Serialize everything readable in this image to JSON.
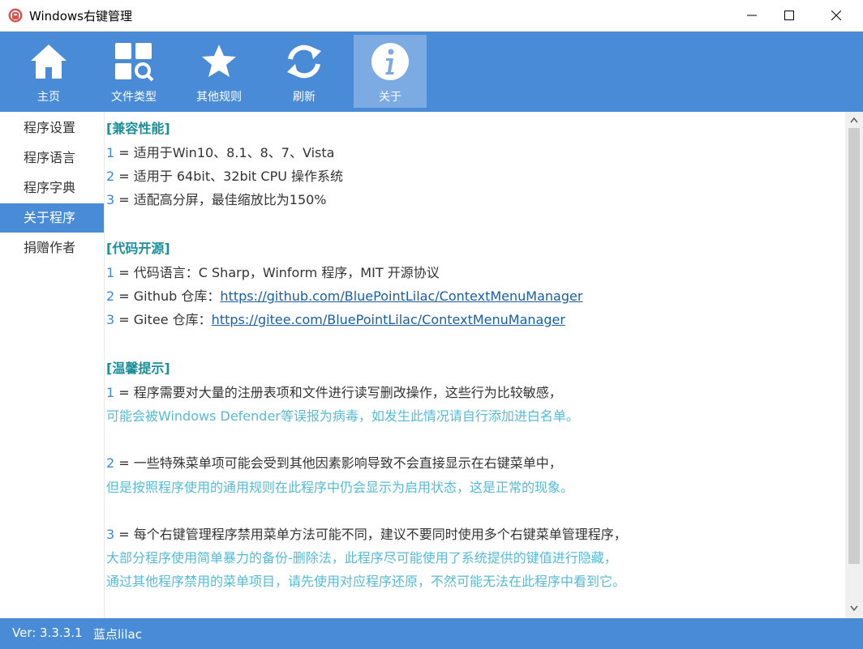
{
  "window": {
    "title": "Windows右键管理"
  },
  "toolbar": {
    "items": [
      {
        "label": "主页",
        "icon": "home-icon"
      },
      {
        "label": "文件类型",
        "icon": "file-type-search-icon"
      },
      {
        "label": "其他规则",
        "icon": "star-icon"
      },
      {
        "label": "刷新",
        "icon": "refresh-icon"
      },
      {
        "label": "关于",
        "icon": "info-icon",
        "active": true
      }
    ]
  },
  "sidebar": {
    "items": [
      {
        "label": "程序设置"
      },
      {
        "label": "程序语言"
      },
      {
        "label": "程序字典"
      },
      {
        "label": "关于程序",
        "active": true
      },
      {
        "label": "捐赠作者"
      }
    ]
  },
  "content": {
    "compat": {
      "heading": "[兼容性能]",
      "items": [
        {
          "num": "1",
          "text": " = 适用于Win10、8.1、8、7、Vista"
        },
        {
          "num": "2",
          "text": " = 适用于 64bit、32bit CPU 操作系统"
        },
        {
          "num": "3",
          "text": " = 适配高分屏，最佳缩放比为150%"
        }
      ]
    },
    "opensource": {
      "heading": "[代码开源]",
      "items": [
        {
          "num": "1",
          "text": " = 代码语言：C Sharp，Winform 程序，MIT 开源协议"
        },
        {
          "num": "2",
          "text": " = Github 仓库：",
          "link": "https://github.com/BluePointLilac/ContextMenuManager"
        },
        {
          "num": "3",
          "text": " = Gitee 仓库：",
          "link": "https://gitee.com/BluePointLilac/ContextMenuManager"
        }
      ]
    },
    "tips": {
      "heading": "[温馨提示]",
      "items": [
        {
          "num": "1",
          "text": " = 程序需要对大量的注册表项和文件进行读写删改操作，这些行为比较敏感，",
          "sub": [
            "可能会被Windows Defender等误报为病毒，如发生此情况请自行添加进白名单。"
          ]
        },
        {
          "num": "2",
          "text": " = 一些特殊菜单项可能会受到其他因素影响导致不会直接显示在右键菜单中，",
          "sub": [
            "但是按照程序使用的通用规则在此程序中仍会显示为启用状态，这是正常的现象。"
          ]
        },
        {
          "num": "3",
          "text": " = 每个右键管理程序禁用菜单方法可能不同，建议不要同时使用多个右键菜单管理程序，",
          "sub": [
            "大部分程序使用简单暴力的备份-删除法，此程序尽可能使用了系统提供的键值进行隐藏，",
            "通过其他程序禁用的菜单项目，请先使用对应程序还原，不然可能无法在此程序中看到它。"
          ]
        }
      ]
    }
  },
  "status": {
    "version": "Ver: 3.3.3.1",
    "author": "蓝点lilac"
  },
  "colors": {
    "accent": "#4a8bd8",
    "heading": "#1a8f9a",
    "number": "#3c8ad8",
    "subtext": "#55bbd6",
    "link": "#1b5ea8"
  }
}
